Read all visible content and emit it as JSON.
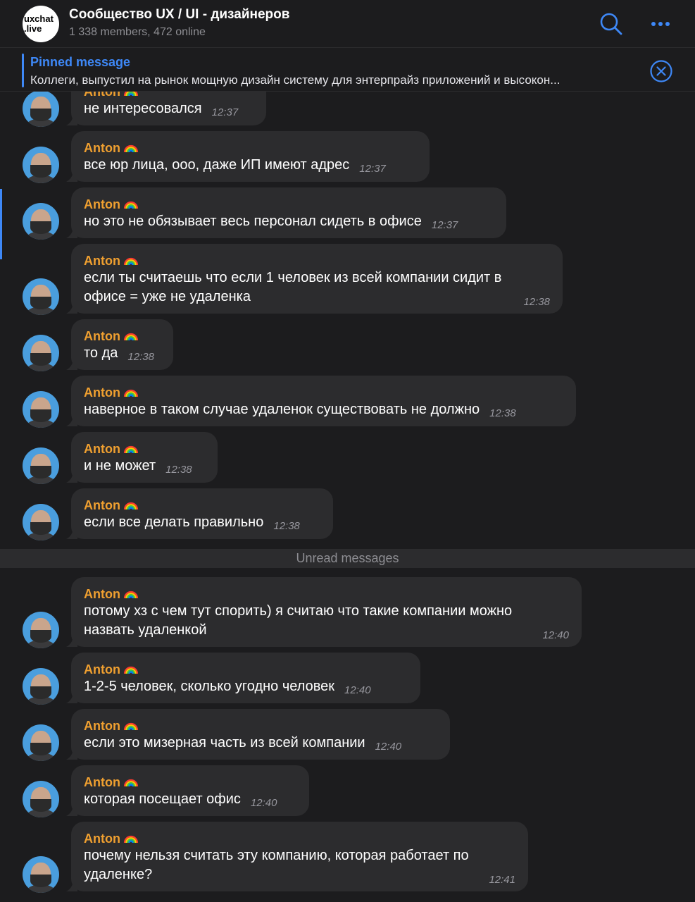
{
  "header": {
    "avatar_text": "uxchat\n.live",
    "title": "Сообщество UX / UI - дизайнеров",
    "subtitle": "1 338 members, 472 online",
    "search_icon": "search-icon",
    "more_icon": "more-icon"
  },
  "pinned": {
    "title": "Pinned message",
    "text": "Коллеги, выпустил на рынок мощную дизайн систему для энтерпрайз приложений и высокон...",
    "close_icon": "close-circle-icon"
  },
  "separator": {
    "label": "Unread messages"
  },
  "colors": {
    "accent": "#3e88f7",
    "sender": "#f0a030",
    "bubble": "#2c2c2e",
    "background": "#1c1c1e"
  },
  "messages": [
    {
      "sender": "Anton",
      "text": "не интересовался",
      "time": "12:37"
    },
    {
      "sender": "Anton",
      "text": "все юр лица, ооо, даже ИП имеют адрес",
      "time": "12:37"
    },
    {
      "sender": "Anton",
      "text": "но это не обязывает весь персонал сидеть в офисе",
      "time": "12:37"
    },
    {
      "sender": "Anton",
      "text": "если ты считаешь что если 1 человек из всей компании сидит в\nофисе = уже не удаленка",
      "time": "12:38"
    },
    {
      "sender": "Anton",
      "text": "то да",
      "time": "12:38"
    },
    {
      "sender": "Anton",
      "text": "наверное в таком случае удаленок существовать не должно",
      "time": "12:38"
    },
    {
      "sender": "Anton",
      "text": "и не может",
      "time": "12:38"
    },
    {
      "sender": "Anton",
      "text": "если все делать правильно",
      "time": "12:38"
    },
    {
      "sender": "Anton",
      "text": "потому хз с чем тут спорить) я считаю что такие компании можно\nназвать удаленкой",
      "time": "12:40"
    },
    {
      "sender": "Anton",
      "text": "1-2-5 человек, сколько угодно человек",
      "time": "12:40"
    },
    {
      "sender": "Anton",
      "text": "если это мизерная часть из всей компании",
      "time": "12:40"
    },
    {
      "sender": "Anton",
      "text": "которая посещает офис",
      "time": "12:40"
    },
    {
      "sender": "Anton",
      "text": "почему нельзя считать эту компанию, которая работает по\nудаленке?",
      "time": "12:41"
    }
  ]
}
